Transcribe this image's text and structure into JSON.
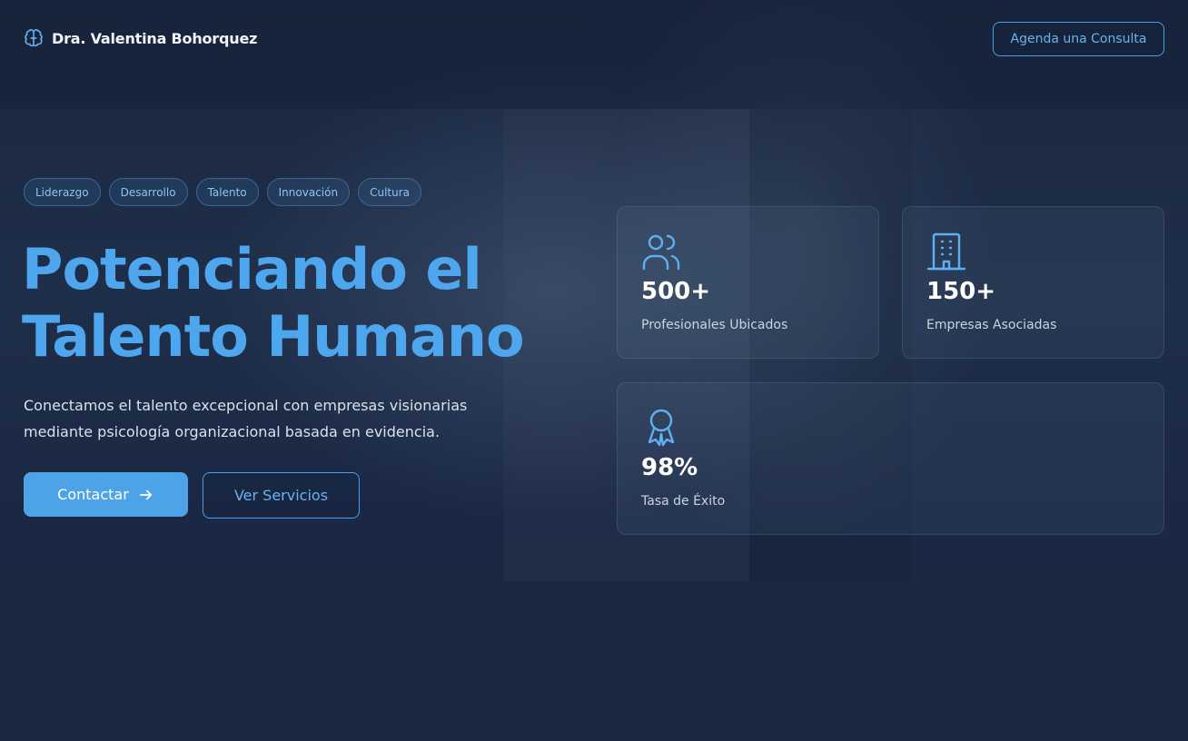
{
  "header": {
    "brand_name": "Dra. Valentina Bohorquez",
    "brand_icon": "brain-icon",
    "cta_label": "Agenda una Consulta"
  },
  "tags": [
    "Liderazgo",
    "Desarrollo",
    "Talento",
    "Innovación",
    "Cultura"
  ],
  "hero": {
    "title_line1": "Potenciando el",
    "title_line2": "Talento Humano",
    "subtitle_line1": "Conectamos el talento excepcional con empresas visionarias",
    "subtitle_line2": "mediante psicología organizacional basada en evidencia.",
    "primary_button": "Contactar",
    "primary_button_icon": "arrow-right-icon",
    "secondary_button": "Ver Servicios"
  },
  "stats": [
    {
      "icon": "users-icon",
      "value": "500+",
      "label": "Profesionales Ubicados"
    },
    {
      "icon": "building-icon",
      "value": "150+",
      "label": "Empresas Asociadas"
    },
    {
      "icon": "award-icon",
      "value": "98%",
      "label": "Tasa de Éxito"
    }
  ],
  "colors": {
    "accent": "#4ea7ee",
    "background": "#1b2a44",
    "button_primary": "#4ea3e8"
  }
}
